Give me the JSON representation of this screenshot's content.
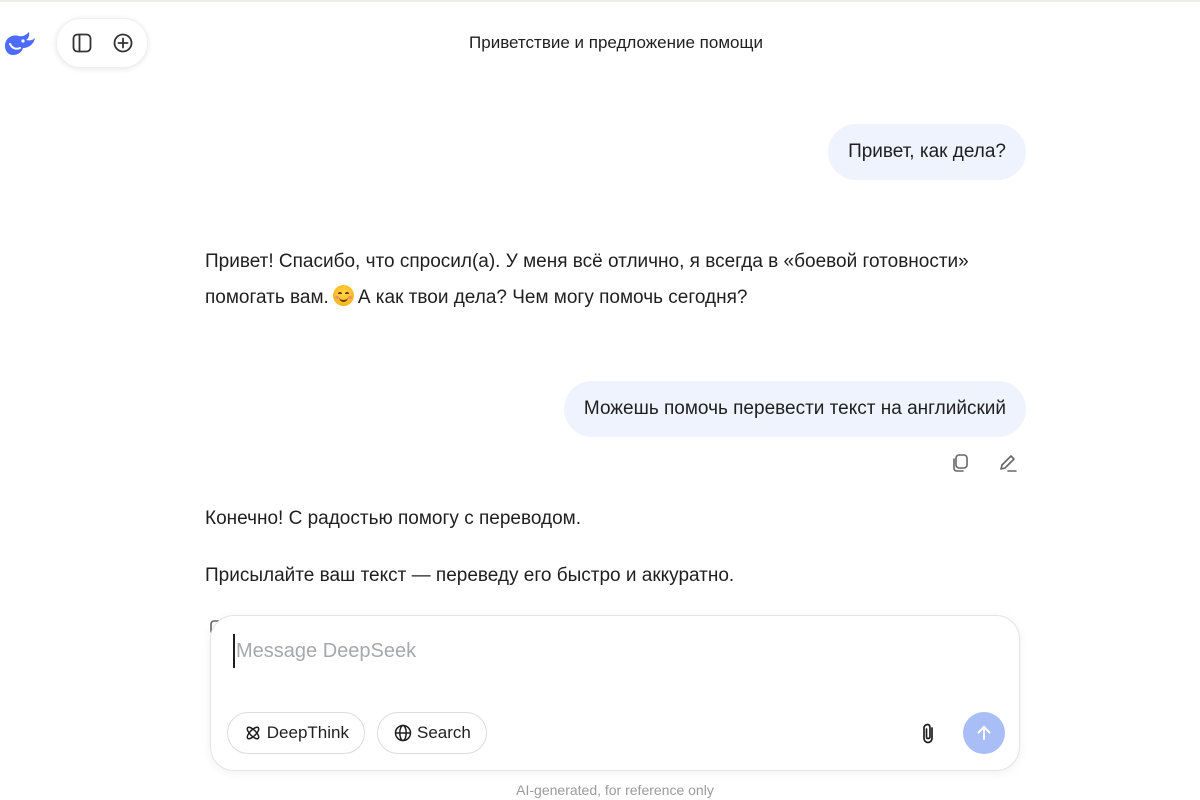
{
  "app": {
    "logo_icon": "deepseek-whale-icon",
    "brand_color": "#4d6bfe",
    "sidebar_toggle_icon": "sidebar-toggle-icon",
    "new_chat_icon": "plus-circle-icon"
  },
  "header": {
    "title": "Приветствие и предложение помощи"
  },
  "messages": [
    {
      "role": "user",
      "text": "Привет, как дела?"
    },
    {
      "role": "assistant",
      "line1_before_emoji": "Привет! Спасибо, что спросил(а). У меня всё отлично, я всегда в «боевой готовности» помогать вам.",
      "emoji": "smiling-face-emoji",
      "line1_after_emoji": "А как твои дела? Чем могу помочь сегодня?"
    },
    {
      "role": "user",
      "text": "Можешь помочь перевести текст на английский"
    },
    {
      "role": "assistant",
      "paragraphs": [
        "Конечно! С радостью помогу с переводом.",
        "Присылайте ваш текст — переведу его быстро и аккуратно."
      ]
    }
  ],
  "message_actions": {
    "copy_icon": "copy-icon",
    "edit_icon": "edit-icon"
  },
  "composer": {
    "placeholder": "Message DeepSeek",
    "value": "",
    "deepthink_label": "DeepThink",
    "deepthink_icon": "atom-icon",
    "search_label": "Search",
    "search_icon": "globe-icon",
    "attach_icon": "paperclip-icon",
    "send_icon": "arrow-up-icon",
    "send_color": "#a9bdf6"
  },
  "footer": {
    "disclaimer": "AI-generated, for reference only"
  }
}
